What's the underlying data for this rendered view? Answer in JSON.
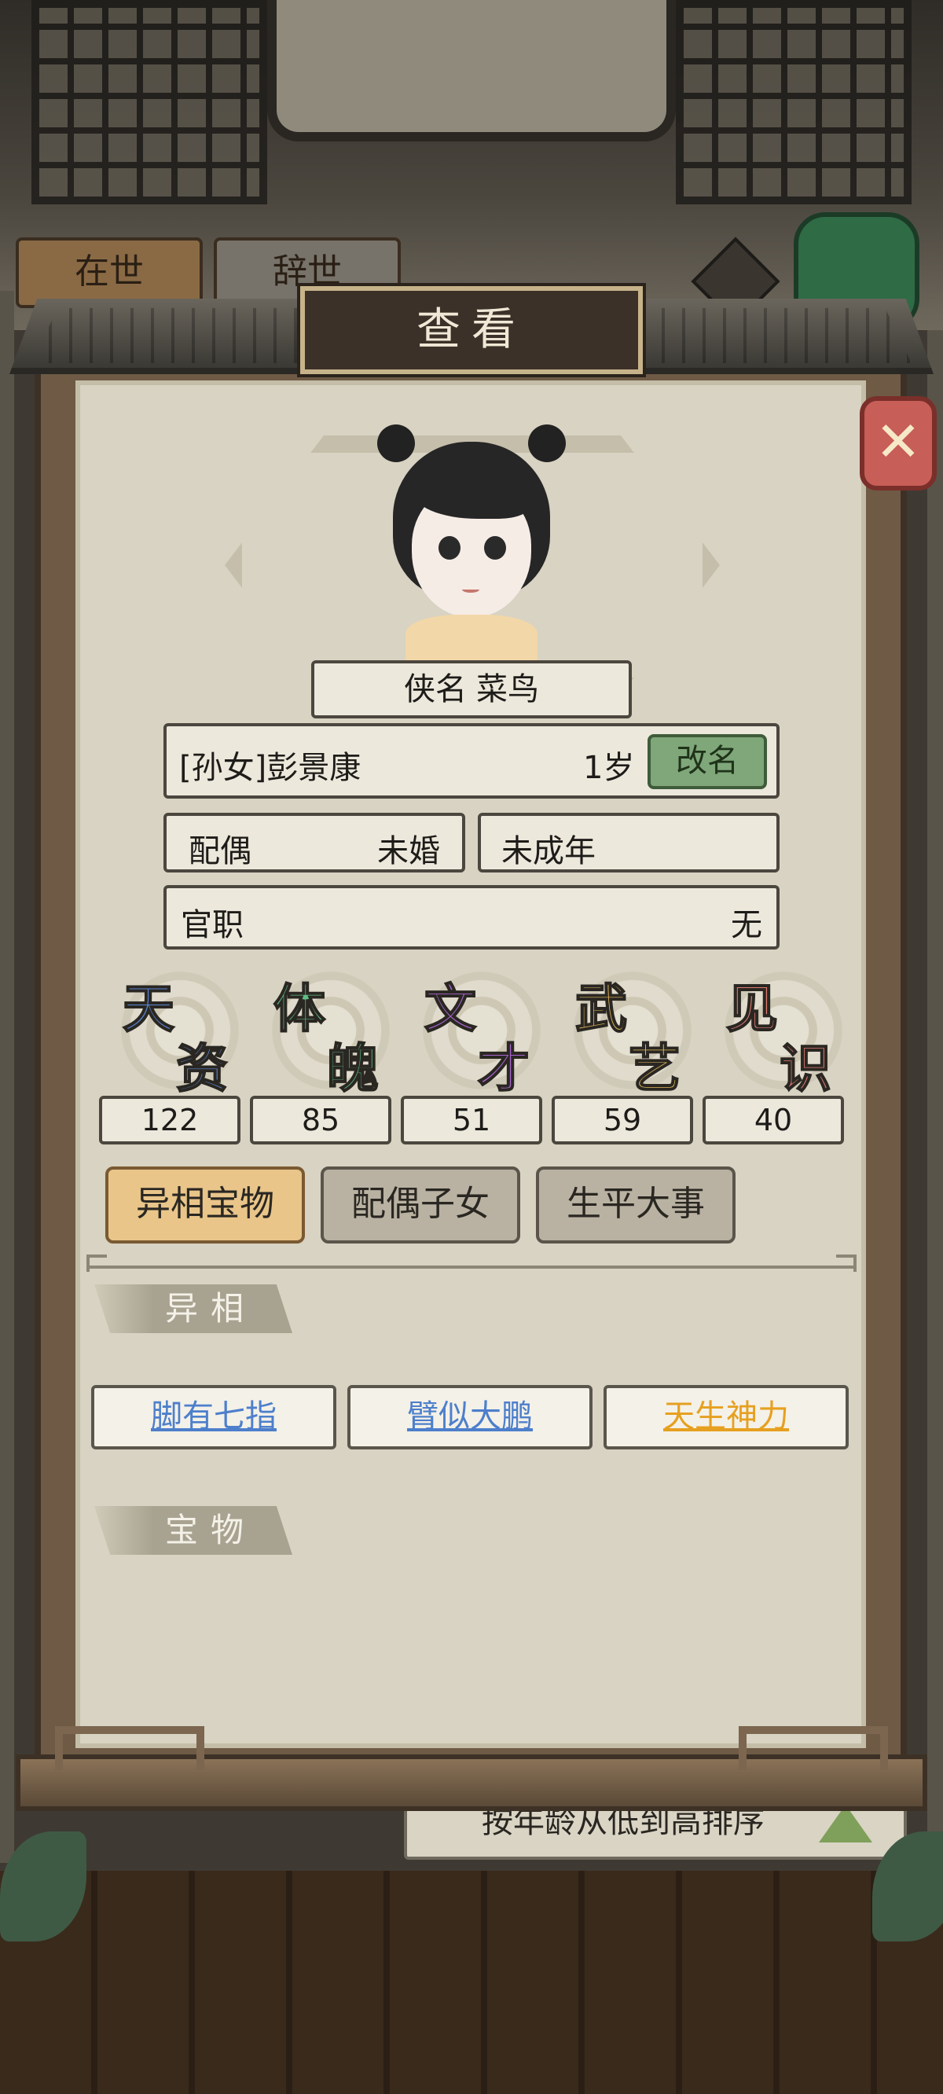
{
  "background": {
    "tabs": [
      "在世",
      "辞世"
    ],
    "help_icon": "?",
    "sort_label": "按年龄从低到高排序"
  },
  "dialog": {
    "title": "查看",
    "close_icon": "close-x-icon"
  },
  "profile": {
    "nickname_label": "侠名",
    "nickname": "菜鸟",
    "name": "[孙女]彭景康",
    "age": "1岁",
    "rename_label": "改名",
    "spouse_label": "配偶",
    "spouse_value": "未婚",
    "adult_status": "未成年",
    "office_label": "官职",
    "office_value": "无"
  },
  "attributes": [
    {
      "c1": "天",
      "c2": "资",
      "value": "122",
      "color": "#5a86d6"
    },
    {
      "c1": "体",
      "c2": "魄",
      "value": "85",
      "color": "#5fbf86"
    },
    {
      "c1": "文",
      "c2": "才",
      "value": "51",
      "color": "#a864cf"
    },
    {
      "c1": "武",
      "c2": "艺",
      "value": "59",
      "color": "#e6bb5c"
    },
    {
      "c1": "见",
      "c2": "识",
      "value": "40",
      "color": "#e07b72"
    }
  ],
  "tabs": [
    {
      "label": "异相宝物",
      "active": true
    },
    {
      "label": "配偶子女",
      "active": false
    },
    {
      "label": "生平大事",
      "active": false
    }
  ],
  "sections": {
    "traits_title": "异相",
    "treasures_title": "宝物"
  },
  "traits": [
    {
      "label": "脚有七指",
      "color": "#4d7fcc"
    },
    {
      "label": "臂似大鹏",
      "color": "#4d7fcc"
    },
    {
      "label": "天生神力",
      "color": "#e6a020"
    }
  ]
}
